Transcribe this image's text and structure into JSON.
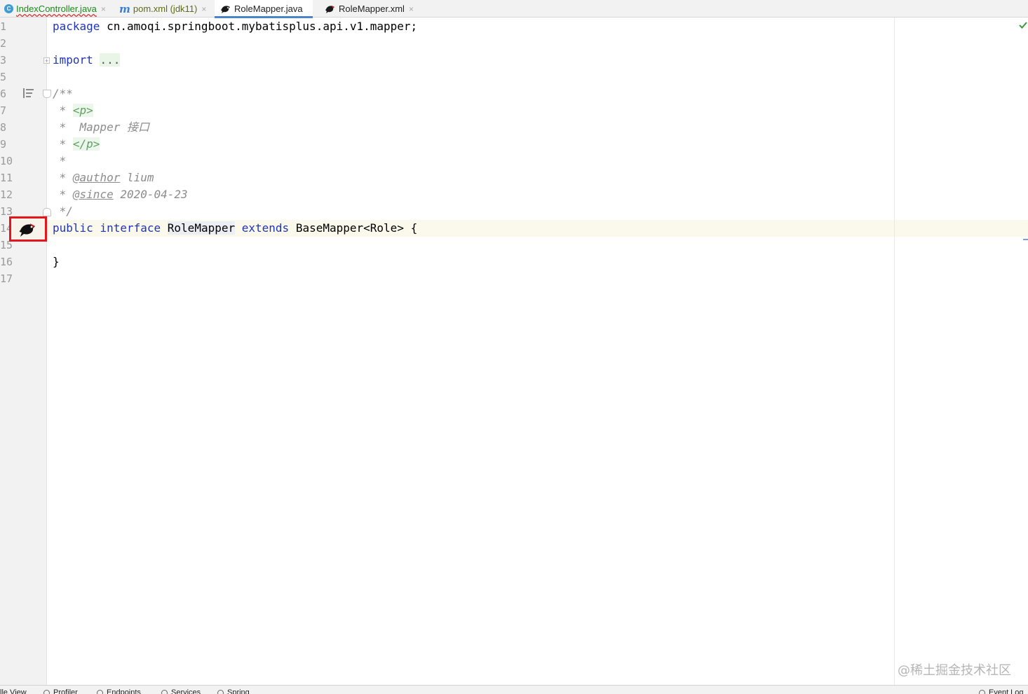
{
  "tabs": [
    {
      "label": "IndexController.java",
      "icon": "class-c-icon",
      "close": "×"
    },
    {
      "label": "pom.xml (jdk11)",
      "icon": "maven-m-icon",
      "close": "×"
    },
    {
      "label": "RoleMapper.java",
      "icon": "mybatis-bird-icon",
      "active": true
    },
    {
      "label": "RoleMapper.xml",
      "icon": "mybatis-bird-red-icon",
      "close": "×"
    }
  ],
  "gutter": {
    "line_numbers": [
      "1",
      "2",
      "3",
      "5",
      "6",
      "7",
      "8",
      "9",
      "10",
      "11",
      "12",
      "13",
      "14",
      "15",
      "16",
      "17"
    ]
  },
  "code": {
    "l1_kw": "package",
    "l1_rest": " cn.amoqi.springboot.mybatisplus.api.v1.mapper;",
    "l3_kw": "import",
    "l3_fold": "...",
    "l6": "/**",
    "l7_star": " * ",
    "l7_tag": "<p>",
    "l8": " *  Mapper 接口",
    "l9_star": " * ",
    "l9_tag": "</p>",
    "l10": " *",
    "l11_star": " * ",
    "l11_tag": "@author",
    "l11_val": " lium",
    "l12_star": " * ",
    "l12_tag": "@since",
    "l12_val": " 2020-04-23",
    "l13": " */",
    "l14_public": "public",
    "l14_interface": "interface",
    "l14_name": "RoleMapper",
    "l14_extends": "extends",
    "l14_rest": " BaseMapper<Role> {",
    "l16": "}"
  },
  "watermark": "@稀土掘金技术社区",
  "bottom_bar": [
    "lle View",
    "Profiler",
    "Endpoints",
    "Services",
    "Spring",
    "Event Log"
  ],
  "colors": {
    "keyword": "#1f35b8",
    "comment": "#8c8c8c",
    "highlight_box": "#e6141d",
    "active_tab_underline": "#4a86c7"
  }
}
